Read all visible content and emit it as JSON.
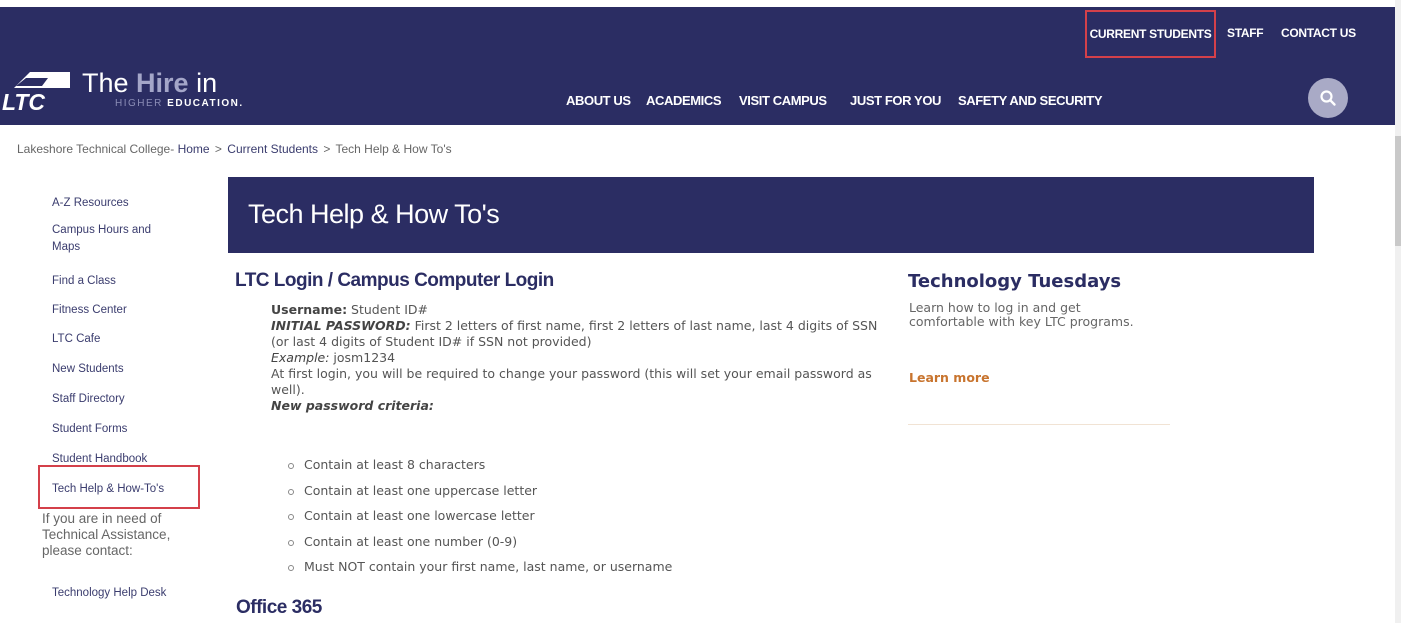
{
  "colors": {
    "brand_navy": "#2b2d63",
    "highlight_red": "#d4404a",
    "link_orange": "#c8742e"
  },
  "header": {
    "logo": {
      "mark": "LTC",
      "text_a": "The ",
      "text_b": "Hire",
      "text_c": " in",
      "sub_a": "HIGHER",
      "sub_b": " EDUCATION."
    },
    "utility_nav": {
      "current_students": "CURRENT STUDENTS",
      "staff": "STAFF",
      "contact_us": "CONTACT US"
    },
    "main_nav": [
      "ABOUT US",
      "ACADEMICS",
      "VISIT CAMPUS",
      "JUST FOR YOU",
      "SAFETY AND SECURITY"
    ],
    "search_icon": "search-icon"
  },
  "breadcrumb": {
    "prefix": "Lakeshore Technical College-",
    "home": "Home",
    "current_students": "Current Students",
    "current": "Tech Help & How To's",
    "separator": ">"
  },
  "sidebar": {
    "items": [
      "A-Z Resources",
      "Campus Hours and Maps",
      "Find a Class",
      "Fitness Center",
      "LTC Cafe",
      "New Students",
      "Staff Directory",
      "Student Forms",
      "Student Handbook",
      "Tech Help & How-To's"
    ],
    "help_text": "If you are in need of Technical Assistance, please contact:",
    "help_link": "Technology Help Desk"
  },
  "page": {
    "title": "Tech Help & How To's",
    "section_title": "LTC Login / Campus Computer Login",
    "username_label": "Username:",
    "username_value": " Student ID#",
    "initial_pw_label": "INITIAL PASSWORD:",
    "initial_pw_value": " First 2 letters of first name, first 2 letters of last name, last 4 digits of SSN (or last 4 digits of Student ID# if SSN not provided)",
    "example_label": "Example:",
    "example_value": " josm1234",
    "first_login_note": "At first login, you will be required to change your password (this will set your email password as well).",
    "criteria_label": "New password criteria:",
    "criteria": [
      "Contain at least 8 characters",
      "Contain at least one uppercase letter",
      "Contain at least one lowercase letter",
      "Contain at least one number (0-9)",
      "Must NOT contain your first name, last name, or username"
    ],
    "office_title": "Office 365"
  },
  "aside": {
    "title": "Technology Tuesdays",
    "description": "Learn how to log in and get comfortable with key LTC programs.",
    "link": "Learn more"
  }
}
